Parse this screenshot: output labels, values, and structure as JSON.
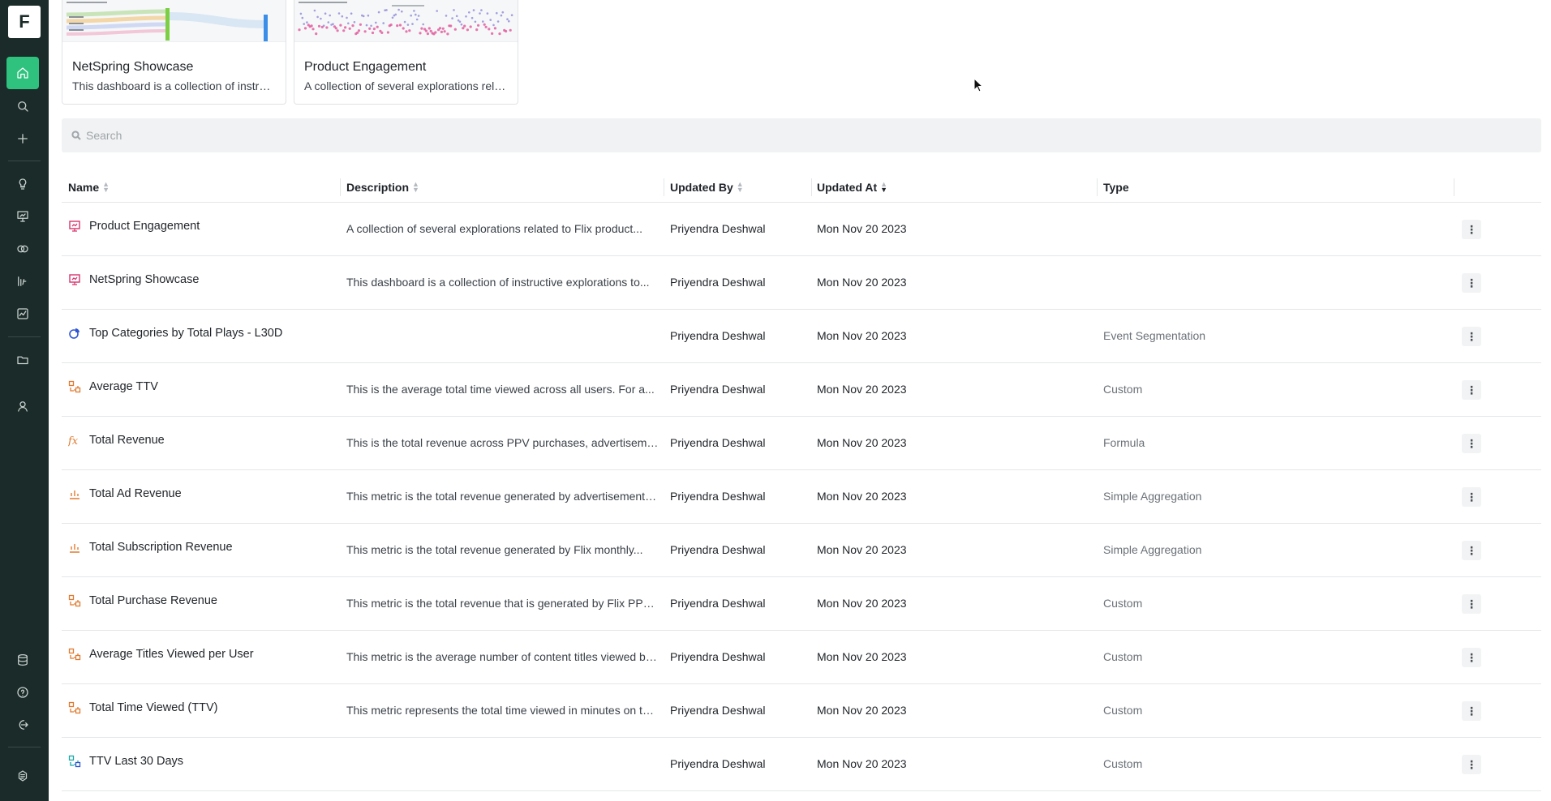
{
  "app": {
    "logo_letter": "F"
  },
  "sidebar": {
    "items": [
      {
        "name": "home",
        "icon": "home-icon",
        "active": true
      },
      {
        "name": "search",
        "icon": "search-icon"
      },
      {
        "name": "create",
        "icon": "plus-icon"
      },
      {
        "name": "insights",
        "icon": "lightbulb-icon"
      },
      {
        "name": "dashboards",
        "icon": "presentation-icon"
      },
      {
        "name": "segments",
        "icon": "overlap-circles-icon"
      },
      {
        "name": "metrics",
        "icon": "metric-formula-icon"
      },
      {
        "name": "explorations",
        "icon": "line-chart-icon"
      },
      {
        "name": "folders",
        "icon": "folder-icon"
      },
      {
        "name": "users",
        "icon": "user-icon"
      },
      {
        "name": "data",
        "icon": "database-icon"
      },
      {
        "name": "help",
        "icon": "help-icon"
      },
      {
        "name": "logout",
        "icon": "logout-icon"
      },
      {
        "name": "brand",
        "icon": "brand-icon"
      }
    ]
  },
  "cards": [
    {
      "title": "NetSpring Showcase",
      "description": "This dashboard is a collection of instruc..."
    },
    {
      "title": "Product Engagement",
      "description": "A collection of several explorations relat..."
    }
  ],
  "search": {
    "placeholder": "Search"
  },
  "table": {
    "columns": {
      "name": "Name",
      "description": "Description",
      "updated_by": "Updated By",
      "updated_at": "Updated At",
      "type": "Type"
    },
    "rows": [
      {
        "icon": "dashboard-icon",
        "name": "Product Engagement",
        "description": "A collection of several explorations related to Flix product...",
        "updated_by": "Priyendra Deshwal",
        "updated_at": "Mon Nov 20 2023",
        "type": ""
      },
      {
        "icon": "dashboard-icon",
        "name": "NetSpring Showcase",
        "description": "This dashboard is a collection of instructive explorations to...",
        "updated_by": "Priyendra Deshwal",
        "updated_at": "Mon Nov 20 2023",
        "type": ""
      },
      {
        "icon": "segmentation-icon",
        "name": "Top Categories by Total Plays - L30D",
        "description": "",
        "updated_by": "Priyendra Deshwal",
        "updated_at": "Mon Nov 20 2023",
        "type": "Event Segmentation"
      },
      {
        "icon": "custom-metric-icon",
        "name": "Average TTV",
        "description": "This is the average total time viewed across all users. For a...",
        "updated_by": "Priyendra Deshwal",
        "updated_at": "Mon Nov 20 2023",
        "type": "Custom"
      },
      {
        "icon": "formula-icon",
        "name": "Total Revenue",
        "description": "This is the total revenue across PPV purchases, advertisement...",
        "updated_by": "Priyendra Deshwal",
        "updated_at": "Mon Nov 20 2023",
        "type": "Formula"
      },
      {
        "icon": "aggregation-icon",
        "name": "Total Ad Revenue",
        "description": "This metric is the total revenue generated by advertisements ...",
        "updated_by": "Priyendra Deshwal",
        "updated_at": "Mon Nov 20 2023",
        "type": "Simple Aggregation"
      },
      {
        "icon": "aggregation-icon",
        "name": "Total Subscription Revenue",
        "description": "This metric is the total revenue generated by Flix monthly...",
        "updated_by": "Priyendra Deshwal",
        "updated_at": "Mon Nov 20 2023",
        "type": "Simple Aggregation"
      },
      {
        "icon": "custom-metric-icon",
        "name": "Total Purchase Revenue",
        "description": "This metric is the total revenue that is generated by Flix PPV...",
        "updated_by": "Priyendra Deshwal",
        "updated_at": "Mon Nov 20 2023",
        "type": "Custom"
      },
      {
        "icon": "custom-metric-icon",
        "name": "Average Titles Viewed per User",
        "description": "This metric is the average number of content titles viewed by...",
        "updated_by": "Priyendra Deshwal",
        "updated_at": "Mon Nov 20 2023",
        "type": "Custom"
      },
      {
        "icon": "custom-metric-icon",
        "name": "Total Time Viewed (TTV)",
        "description": "This metric represents the total time viewed in minutes on the...",
        "updated_by": "Priyendra Deshwal",
        "updated_at": "Mon Nov 20 2023",
        "type": "Custom"
      },
      {
        "icon": "custom-metric-teal-icon",
        "name": "TTV Last 30 Days",
        "description": "",
        "updated_by": "Priyendra Deshwal",
        "updated_at": "Mon Nov 20 2023",
        "type": "Custom"
      }
    ]
  },
  "colors": {
    "sidebar_bg": "#1b2b29",
    "active_green": "#2ec27e",
    "dashboard_pink": "#d6336c",
    "segmentation_blue": "#2f55d4",
    "metric_orange": "#e07a2f",
    "teal": "#1aa6a6"
  }
}
